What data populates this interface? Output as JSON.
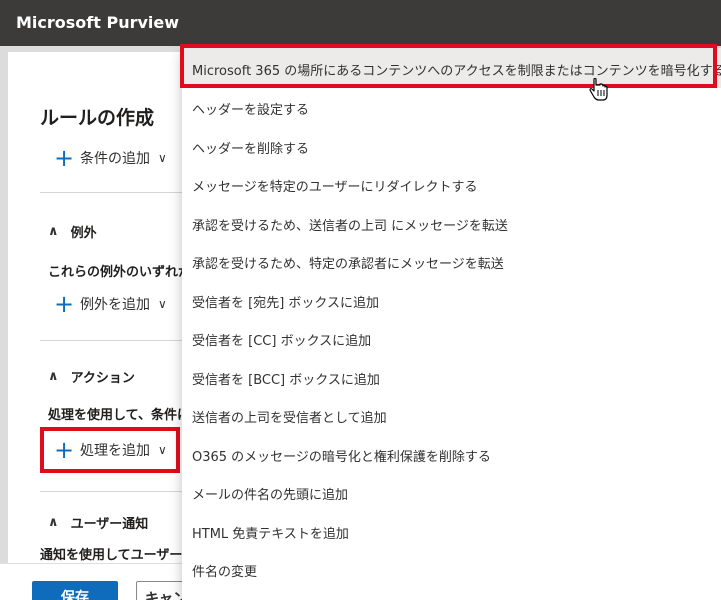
{
  "app": {
    "title": "Microsoft Purview"
  },
  "panel": {
    "title": "ルールの作成",
    "add_condition": "条件の追加",
    "exceptions": {
      "heading": "例外",
      "description": "これらの例外のいずれかが",
      "add_label": "例外を追加"
    },
    "actions": {
      "heading": "アクション",
      "description": "処理を使用して、条件に",
      "add_label": "処理を追加"
    },
    "user_notify": {
      "heading": "ユーザー通知",
      "description": "通知を使用してユーザーに"
    }
  },
  "footer": {
    "save_label": "保存",
    "cancel_label": "キャン"
  },
  "dropdown": {
    "items": [
      "Microsoft 365 の場所にあるコンテンツへのアクセスを制限またはコンテンツを暗号化する",
      "ヘッダーを設定する",
      "ヘッダーを削除する",
      "メッセージを特定のユーザーにリダイレクトする",
      "承認を受けるため、送信者の上司 にメッセージを転送",
      "承認を受けるため、特定の承認者にメッセージを転送",
      "受信者を [宛先] ボックスに追加",
      "受信者を [CC] ボックスに追加",
      "受信者を [BCC] ボックスに追加",
      "送信者の上司を受信者として追加",
      "O365 のメッセージの暗号化と権利保護を削除する",
      "メールの件名の先頭に追加",
      "HTML 免責テキストを追加",
      "件名の変更"
    ]
  },
  "colors": {
    "accent": "#0f6cbd",
    "highlight": "#e00c1d",
    "topbar": "#3c3b3a"
  },
  "icons": {
    "add": "plus-icon",
    "expand": "chevron-down-icon",
    "collapse": "chevron-up-icon",
    "cursor": "hand-cursor-icon"
  }
}
